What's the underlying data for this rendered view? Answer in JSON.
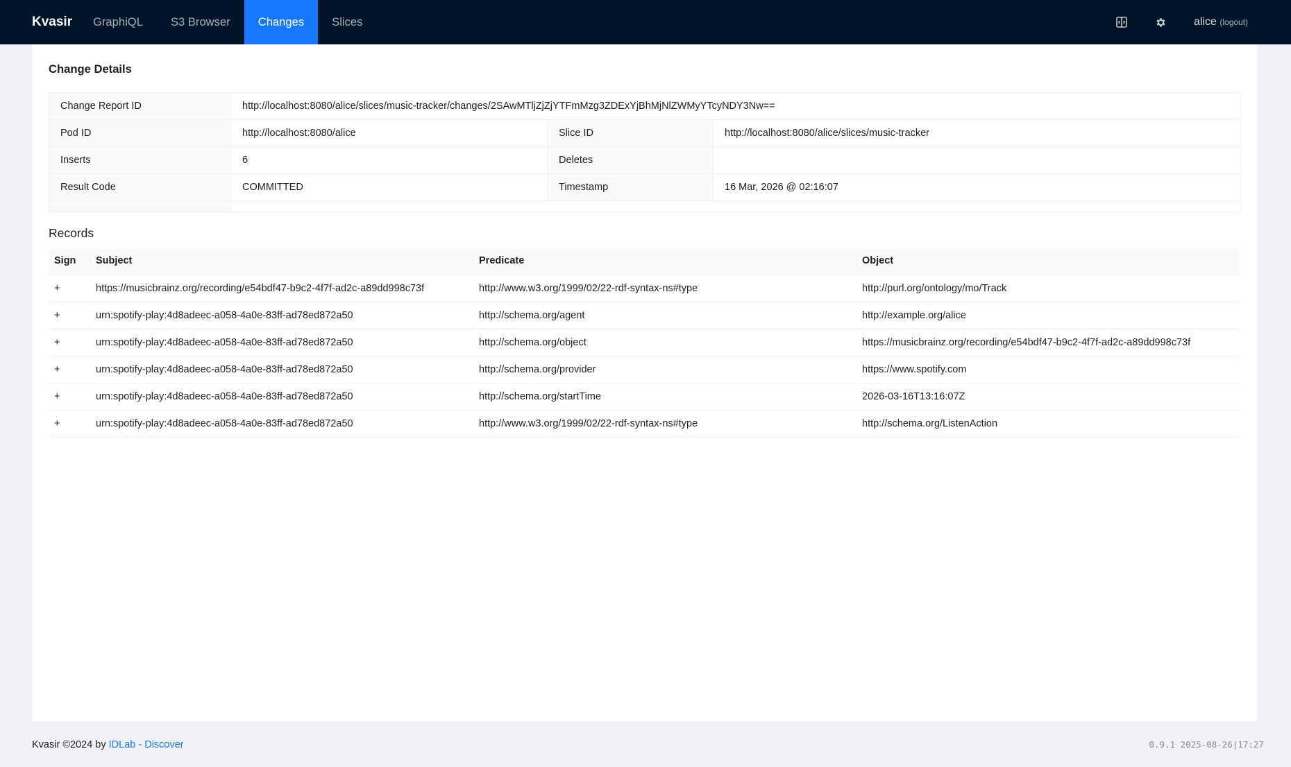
{
  "header": {
    "logo": "Kvasir",
    "nav": [
      "GraphiQL",
      "S3 Browser",
      "Changes",
      "Slices"
    ],
    "user": "alice",
    "logout": "(logout)"
  },
  "details": {
    "title": "Change Details",
    "change_report_id_label": "Change Report ID",
    "change_report_id": "http://localhost:8080/alice/slices/music-tracker/changes/2SAwMTljZjZjYTFmMzg3ZDExYjBhMjNlZWMyYTcyNDY3Nw==",
    "pod_id_label": "Pod ID",
    "pod_id": "http://localhost:8080/alice",
    "slice_id_label": "Slice ID",
    "slice_id": "http://localhost:8080/alice/slices/music-tracker",
    "inserts_label": "Inserts",
    "inserts": "6",
    "deletes_label": "Deletes",
    "deletes": "",
    "result_code_label": "Result Code",
    "result_code": "COMMITTED",
    "timestamp_label": "Timestamp",
    "timestamp": "16 Mar, 2026 @ 02:16:07"
  },
  "records": {
    "title": "Records",
    "columns": [
      "Sign",
      "Subject",
      "Predicate",
      "Object"
    ],
    "rows": [
      [
        "+",
        "https://musicbrainz.org/recording/e54bdf47-b9c2-4f7f-ad2c-a89dd998c73f",
        "http://www.w3.org/1999/02/22-rdf-syntax-ns#type",
        "http://purl.org/ontology/mo/Track"
      ],
      [
        "+",
        "urn:spotify-play:4d8adeec-a058-4a0e-83ff-ad78ed872a50",
        "http://schema.org/agent",
        "http://example.org/alice"
      ],
      [
        "+",
        "urn:spotify-play:4d8adeec-a058-4a0e-83ff-ad78ed872a50",
        "http://schema.org/object",
        "https://musicbrainz.org/recording/e54bdf47-b9c2-4f7f-ad2c-a89dd998c73f"
      ],
      [
        "+",
        "urn:spotify-play:4d8adeec-a058-4a0e-83ff-ad78ed872a50",
        "http://schema.org/provider",
        "https://www.spotify.com"
      ],
      [
        "+",
        "urn:spotify-play:4d8adeec-a058-4a0e-83ff-ad78ed872a50",
        "http://schema.org/startTime",
        "2026-03-16T13:16:07Z"
      ],
      [
        "+",
        "urn:spotify-play:4d8adeec-a058-4a0e-83ff-ad78ed872a50",
        "http://www.w3.org/1999/02/22-rdf-syntax-ns#type",
        "http://schema.org/ListenAction"
      ]
    ]
  },
  "footer": {
    "text": "Kvasir ©2024 by",
    "link": "IDLab - Discover",
    "version": "0.9.1 2025-08-26|17:27"
  },
  "colors": {
    "header_bg": "#001529",
    "accent": "#1677ff",
    "page_bg": "#f0f2f5"
  },
  "icons": [
    "split-view-icon",
    "gear-icon"
  ]
}
